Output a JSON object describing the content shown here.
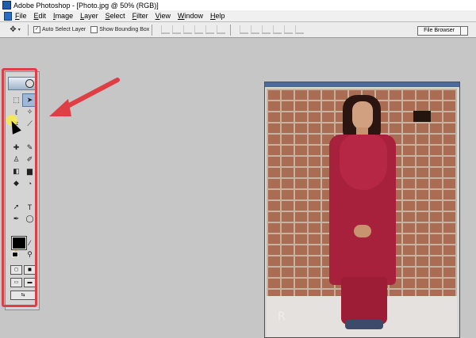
{
  "app": {
    "title": "Adobe Photoshop - [Photo.jpg @ 50% (RGB)]"
  },
  "menu": [
    "File",
    "Edit",
    "Image",
    "Layer",
    "Select",
    "Filter",
    "View",
    "Window",
    "Help"
  ],
  "options": {
    "auto_select_layer": "Auto Select Layer",
    "auto_select_checked": true,
    "show_bounding_box": "Show Bounding Box",
    "show_bounding_checked": false
  },
  "palette_well": {
    "file_browser": "File Browser"
  },
  "toolbox": {
    "tools": [
      "marquee",
      "move",
      "lasso",
      "magic-wand",
      "crop",
      "slice",
      "healing-brush",
      "brush",
      "clone-stamp",
      "history-brush",
      "eraser",
      "gradient",
      "blur",
      "dodge",
      "path-selection",
      "type",
      "pen",
      "shape",
      "notes",
      "eyedropper",
      "hand",
      "zoom"
    ],
    "selected_tool": "move",
    "foreground_color": "#000000",
    "background_color": "#ffffff"
  },
  "annotation": {
    "highlight_color": "#e03e45"
  },
  "photo": {
    "watermark": "R"
  }
}
